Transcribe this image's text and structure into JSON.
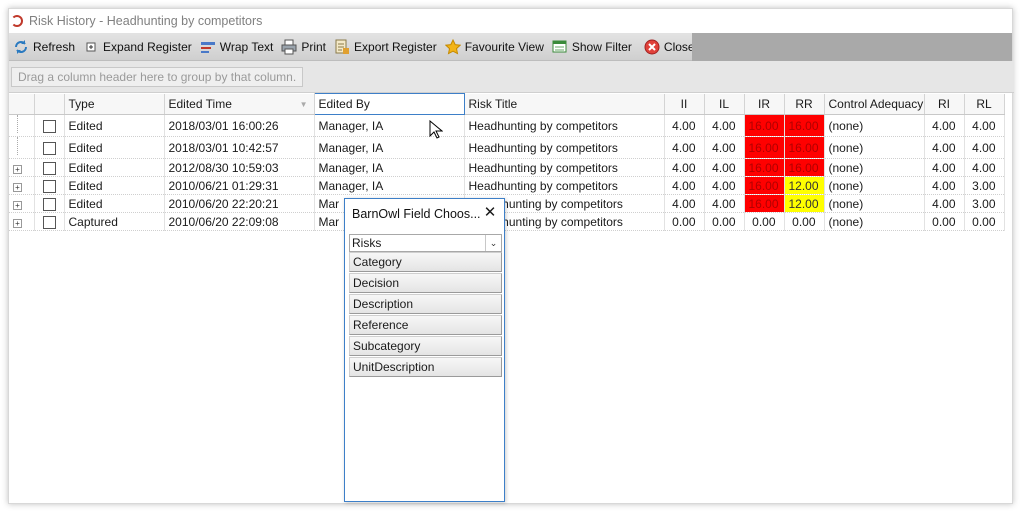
{
  "window": {
    "title": "Risk History - Headhunting by competitors"
  },
  "toolbar": {
    "refresh": "Refresh",
    "expand_register": "Expand Register",
    "wrap_text": "Wrap Text",
    "print": "Print",
    "export_register": "Export Register",
    "favourite_view": "Favourite View",
    "show_filter": "Show Filter",
    "close": "Close"
  },
  "group_area": {
    "hint": "Drag a column header here to group by that column."
  },
  "grid": {
    "columns": {
      "type": "Type",
      "edited_time": "Edited Time",
      "edited_by": "Edited By",
      "risk_title": "Risk Title",
      "ii": "II",
      "il": "IL",
      "ir": "IR",
      "rr": "RR",
      "control_adequacy": "Control Adequacy",
      "ri": "RI",
      "rl": "RL"
    },
    "rows": [
      {
        "type": "Edited",
        "edited_time": "2018/03/01 16:00:26",
        "edited_by": "Manager, IA",
        "risk_title": "Headhunting by competitors",
        "ii": "4.00",
        "il": "4.00",
        "ir": "16.00",
        "rr": "16.00",
        "control_adequacy": "(none)",
        "ri": "4.00",
        "rl": "4.00"
      },
      {
        "type": "Edited",
        "edited_time": "2018/03/01 10:42:57",
        "edited_by": "Manager, IA",
        "risk_title": "Headhunting by competitors",
        "ii": "4.00",
        "il": "4.00",
        "ir": "16.00",
        "rr": "16.00",
        "control_adequacy": "(none)",
        "ri": "4.00",
        "rl": "4.00"
      },
      {
        "type": "Edited",
        "edited_time": "2012/08/30 10:59:03",
        "edited_by": "Manager, IA",
        "risk_title": "Headhunting by competitors",
        "ii": "4.00",
        "il": "4.00",
        "ir": "16.00",
        "rr": "16.00",
        "control_adequacy": "(none)",
        "ri": "4.00",
        "rl": "4.00"
      },
      {
        "type": "Edited",
        "edited_time": "2010/06/21 01:29:31",
        "edited_by": "Manager, IA",
        "risk_title": "Headhunting by competitors",
        "ii": "4.00",
        "il": "4.00",
        "ir": "16.00",
        "rr": "12.00",
        "control_adequacy": "(none)",
        "ri": "4.00",
        "rl": "3.00"
      },
      {
        "type": "Edited",
        "edited_time": "2010/06/20 22:20:21",
        "edited_by": "Mar",
        "risk_title": "nhunting by competitors",
        "ii": "4.00",
        "il": "4.00",
        "ir": "16.00",
        "rr": "12.00",
        "control_adequacy": "(none)",
        "ri": "4.00",
        "rl": "3.00"
      },
      {
        "type": "Captured",
        "edited_time": "2010/06/20 22:09:08",
        "edited_by": "Mar",
        "risk_title": "nhunting by competitors",
        "ii": "0.00",
        "il": "0.00",
        "ir": "0.00",
        "rr": "0.00",
        "control_adequacy": "(none)",
        "ri": "0.00",
        "rl": "0.00"
      }
    ]
  },
  "field_chooser": {
    "title": "BarnOwl Field Choos...",
    "selected": "Risks",
    "items": [
      "Category",
      "Decision",
      "Description",
      "Reference",
      "Subcategory",
      "UnitDescription"
    ]
  },
  "colors": {
    "high": "#ff0000",
    "medium": "#ffff00",
    "accent": "#3d7fc8"
  }
}
